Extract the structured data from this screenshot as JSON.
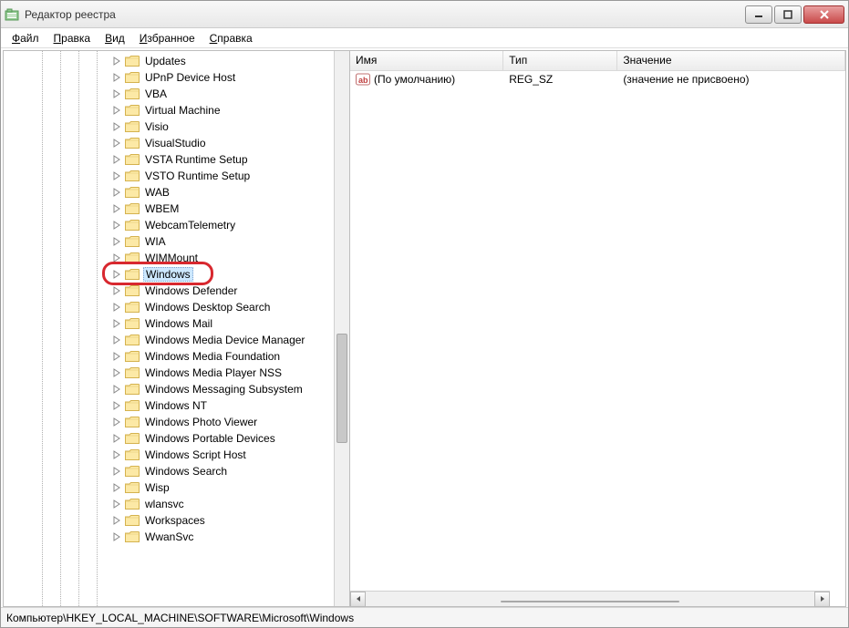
{
  "window": {
    "title": "Редактор реестра"
  },
  "menu": {
    "items": [
      {
        "pre": "",
        "u": "Ф",
        "post": "айл"
      },
      {
        "pre": "",
        "u": "П",
        "post": "равка"
      },
      {
        "pre": "",
        "u": "В",
        "post": "ид"
      },
      {
        "pre": "",
        "u": "И",
        "post": "збранное"
      },
      {
        "pre": "",
        "u": "С",
        "post": "правка"
      }
    ]
  },
  "tree": {
    "selected_index": 14,
    "items": [
      "Updates",
      "UPnP Device Host",
      "VBA",
      "Virtual Machine",
      "Visio",
      "VisualStudio",
      "VSTA Runtime Setup",
      "VSTO Runtime Setup",
      "WAB",
      "WBEM",
      "WebcamTelemetry",
      "WIA",
      "WIMMount",
      "",
      "Windows",
      "Windows Defender",
      "Windows Desktop Search",
      "Windows Mail",
      "Windows Media Device Manager",
      "Windows Media Foundation",
      "Windows Media Player NSS",
      "Windows Messaging Subsystem",
      "Windows NT",
      "Windows Photo Viewer",
      "Windows Portable Devices",
      "Windows Script Host",
      "Windows Search",
      "Wisp",
      "wlansvc",
      "Workspaces",
      "WwanSvc"
    ]
  },
  "list": {
    "columns": {
      "name": "Имя",
      "type": "Тип",
      "value": "Значение"
    },
    "col_widths": {
      "name": 175,
      "type": 130,
      "value": 260
    },
    "rows": [
      {
        "name": "(По умолчанию)",
        "type": "REG_SZ",
        "value": "(значение не присвоено)"
      }
    ]
  },
  "statusbar": {
    "path": "Компьютер\\HKEY_LOCAL_MACHINE\\SOFTWARE\\Microsoft\\Windows"
  },
  "colors": {
    "highlight": "#d8282f"
  }
}
